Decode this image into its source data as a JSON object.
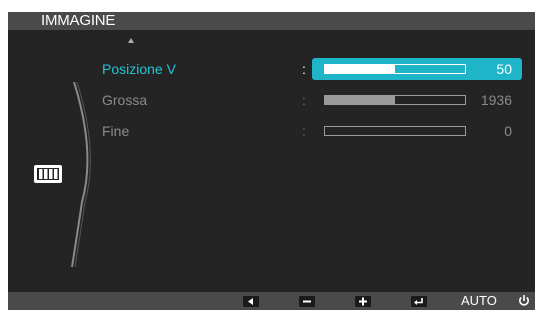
{
  "title": "IMMAGINE",
  "menu": {
    "separator": ":",
    "items": [
      {
        "label": "Posizione V",
        "value": "50",
        "level": 0.5,
        "selected": true
      },
      {
        "label": "Grossa",
        "value": "1936",
        "level": 0.5,
        "selected": false
      },
      {
        "label": "Fine",
        "value": "0",
        "level": 0.0,
        "selected": false
      }
    ]
  },
  "bottom": {
    "buttons": [
      "left-arrow-icon",
      "minus-icon",
      "plus-icon",
      "enter-icon"
    ],
    "auto_label": "AUTO"
  },
  "icons": {
    "scroll": "scroll-up-arrow-icon",
    "category": "picture-category-icon",
    "power": "power-icon"
  },
  "colors": {
    "accent": "#1fb5c9",
    "accent_text": "#20c3d8",
    "panel": "#242424",
    "bars": "#4a4a4a"
  }
}
